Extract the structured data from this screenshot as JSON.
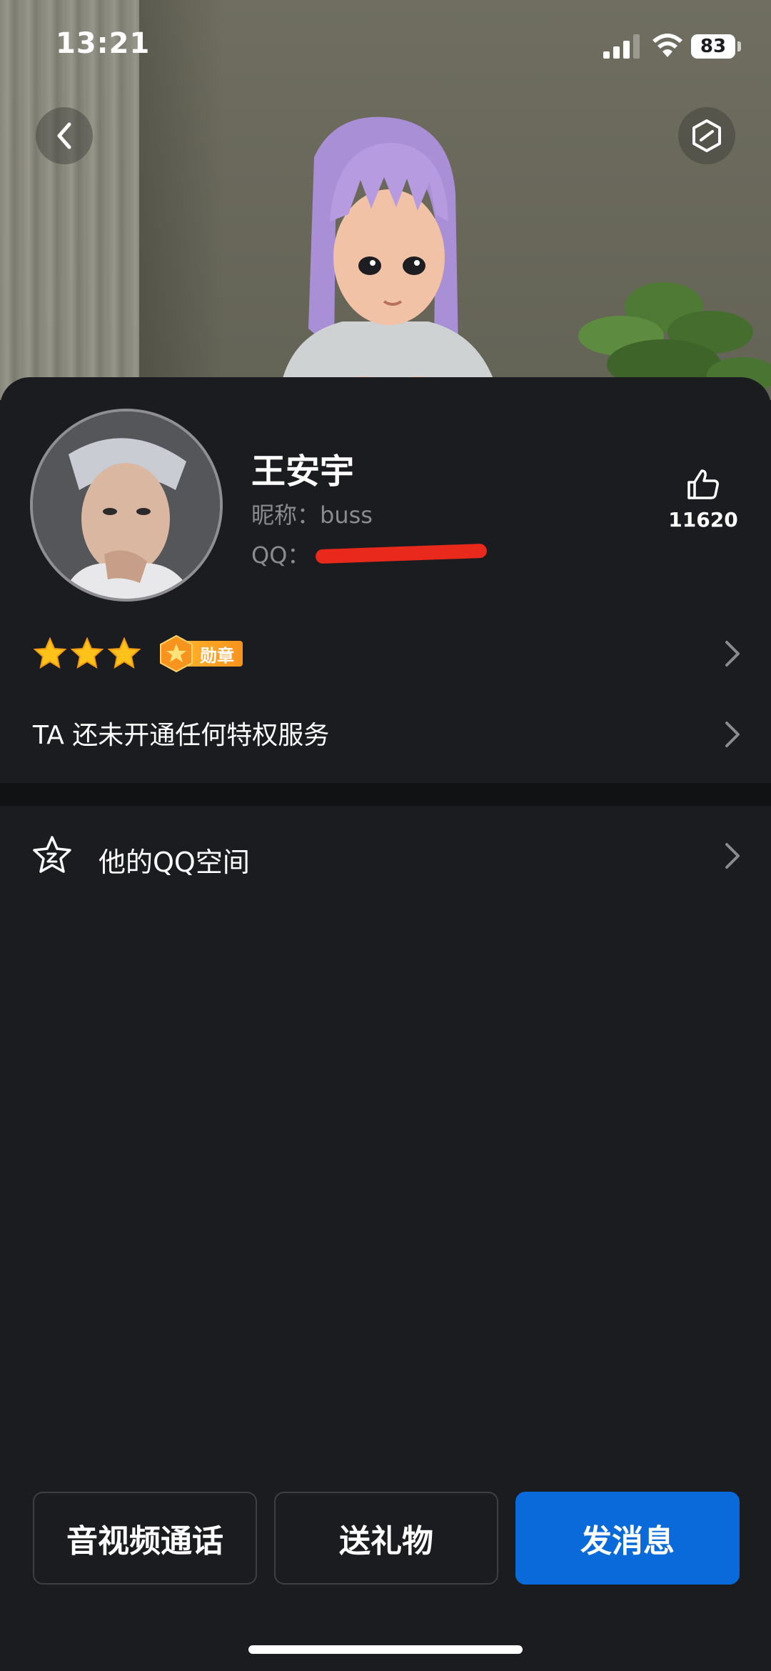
{
  "status_bar": {
    "time": "13:21",
    "battery": "83"
  },
  "hero": {
    "back_icon": "chevron-left-icon",
    "dress_icon": "hexagon-dress-icon"
  },
  "profile": {
    "name": "王安宇",
    "nickname_label": "昵称：",
    "nickname": "buss",
    "qq_label": "QQ：",
    "likes": "11620"
  },
  "level": {
    "stars": 3,
    "medal_label": "勋章"
  },
  "privilege": {
    "text": "TA 还未开通任何特权服务"
  },
  "qzone": {
    "label": "他的QQ空间"
  },
  "actions": {
    "call_label": "音视频通话",
    "gift_label": "送礼物",
    "message_label": "发消息"
  },
  "colors": {
    "accent": "#0a6ad9",
    "background": "#1b1c20",
    "redaction": "#e8291c"
  }
}
